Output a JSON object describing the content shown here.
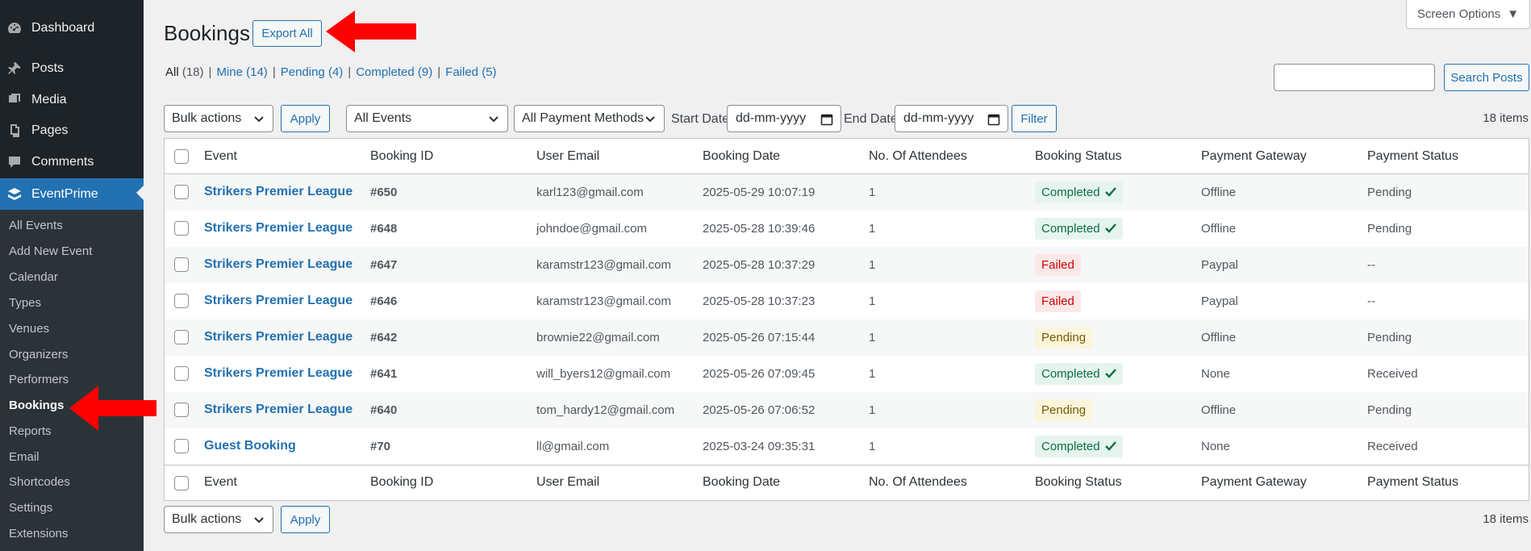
{
  "sidebar": {
    "items": [
      {
        "label": "Dashboard",
        "icon": "dashboard-icon"
      },
      {
        "label": "Posts",
        "icon": "pin-icon"
      },
      {
        "label": "Media",
        "icon": "media-icon"
      },
      {
        "label": "Pages",
        "icon": "pages-icon"
      },
      {
        "label": "Comments",
        "icon": "comment-icon"
      },
      {
        "label": "EventPrime",
        "icon": "eventprime-icon"
      }
    ],
    "submenu": [
      "All Events",
      "Add New Event",
      "Calendar",
      "Types",
      "Venues",
      "Organizers",
      "Performers",
      "Bookings",
      "Reports",
      "Email",
      "Shortcodes",
      "Settings",
      "Extensions"
    ]
  },
  "header": {
    "title": "Bookings",
    "export_label": "Export All",
    "screen_options": "Screen Options"
  },
  "views": [
    {
      "label": "All",
      "count": "(18)"
    },
    {
      "label": "Mine",
      "count": "(14)"
    },
    {
      "label": "Pending",
      "count": "(4)"
    },
    {
      "label": "Completed",
      "count": "(9)"
    },
    {
      "label": "Failed",
      "count": "(5)"
    }
  ],
  "search": {
    "button": "Search Posts",
    "value": ""
  },
  "filters": {
    "bulk_actions": "Bulk actions",
    "apply": "Apply",
    "events": "All Events",
    "payment_methods": "All Payment Methods",
    "start_label": "Start Date",
    "start_value": "dd-mm-yyyy",
    "end_label": "End Date",
    "end_value": "dd-mm-yyyy",
    "filter": "Filter",
    "items_count": "18 items"
  },
  "table": {
    "columns": [
      "Event",
      "Booking ID",
      "User Email",
      "Booking Date",
      "No. Of Attendees",
      "Booking Status",
      "Payment Gateway",
      "Payment Status"
    ],
    "rows": [
      {
        "event": "Strikers Premier League",
        "id": "#650",
        "email": "karl123@gmail.com",
        "date": "2025-05-29 10:07:19",
        "attendees": "1",
        "status": "Completed",
        "gateway": "Offline",
        "payment": "Pending"
      },
      {
        "event": "Strikers Premier League",
        "id": "#648",
        "email": "johndoe@gmail.com",
        "date": "2025-05-28 10:39:46",
        "attendees": "1",
        "status": "Completed",
        "gateway": "Offline",
        "payment": "Pending"
      },
      {
        "event": "Strikers Premier League",
        "id": "#647",
        "email": "karamstr123@gmail.com",
        "date": "2025-05-28 10:37:29",
        "attendees": "1",
        "status": "Failed",
        "gateway": "Paypal",
        "payment": "--"
      },
      {
        "event": "Strikers Premier League",
        "id": "#646",
        "email": "karamstr123@gmail.com",
        "date": "2025-05-28 10:37:23",
        "attendees": "1",
        "status": "Failed",
        "gateway": "Paypal",
        "payment": "--"
      },
      {
        "event": "Strikers Premier League",
        "id": "#642",
        "email": "brownie22@gmail.com",
        "date": "2025-05-26 07:15:44",
        "attendees": "1",
        "status": "Pending",
        "gateway": "Offline",
        "payment": "Pending"
      },
      {
        "event": "Strikers Premier League",
        "id": "#641",
        "email": "will_byers12@gmail.com",
        "date": "2025-05-26 07:09:45",
        "attendees": "1",
        "status": "Completed",
        "gateway": "None",
        "payment": "Received"
      },
      {
        "event": "Strikers Premier League",
        "id": "#640",
        "email": "tom_hardy12@gmail.com",
        "date": "2025-05-26 07:06:52",
        "attendees": "1",
        "status": "Pending",
        "gateway": "Offline",
        "payment": "Pending"
      },
      {
        "event": "Guest Booking",
        "id": "#70",
        "email": "ll@gmail.com",
        "date": "2025-03-24 09:35:31",
        "attendees": "1",
        "status": "Completed",
        "gateway": "None",
        "payment": "Received"
      }
    ]
  },
  "bottom": {
    "bulk_actions": "Bulk actions",
    "apply": "Apply",
    "items_count": "18 items"
  },
  "colors": {
    "accent": "#2271b1",
    "sidebar": "#1d2327",
    "annotation_arrow": "#ff0000"
  }
}
